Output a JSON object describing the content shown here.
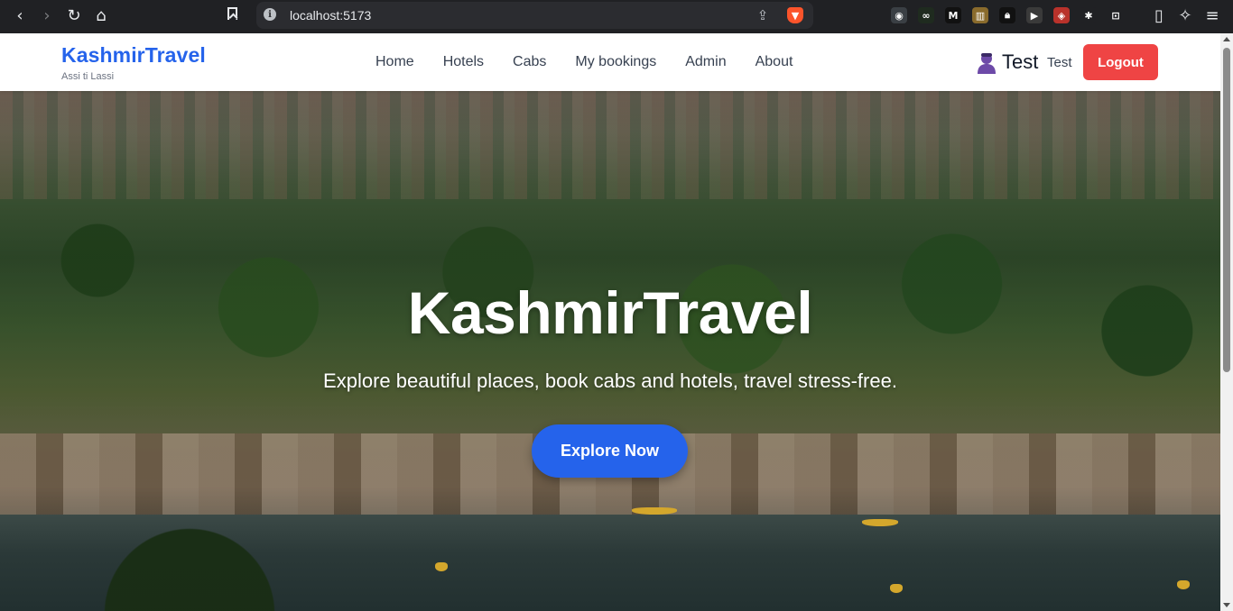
{
  "browser": {
    "url": "localhost:5173",
    "back_icon": "chevron-left-icon",
    "forward_icon": "chevron-right-icon",
    "reload_icon": "reload-icon",
    "home_icon": "home-icon",
    "bookmark_icon": "bookmark-icon",
    "site_info_icon": "info-icon",
    "share_icon": "share-icon",
    "brave_icon": "brave-shield-icon",
    "extensions": [
      {
        "name": "glasses-extension-icon",
        "glyph": "◉",
        "color": "#3a3f44"
      },
      {
        "name": "infinity-extension-icon",
        "glyph": "∞",
        "color": "#1f2b1f"
      },
      {
        "name": "medium-extension-icon",
        "glyph": "M",
        "color": "#111111"
      },
      {
        "name": "colors-extension-icon",
        "glyph": "▥",
        "color": "#8a6b2c"
      },
      {
        "name": "lock-extension-icon",
        "glyph": "🔒︎",
        "color": "#111111"
      },
      {
        "name": "media-extension-icon",
        "glyph": "▶",
        "color": "#3a3a3a"
      },
      {
        "name": "shield-extension-icon",
        "glyph": "◈",
        "color": "#b9322b"
      },
      {
        "name": "puzzle-extension-icon",
        "glyph": "✱",
        "color": "#202124"
      },
      {
        "name": "screenshot-extension-icon",
        "glyph": "⊡",
        "color": "#202124"
      }
    ],
    "sidebar_icon": "sidebar-icon",
    "leo_icon": "sparkle-icon",
    "menu_icon": "menu-icon"
  },
  "navbar": {
    "brand": "KashmirTravel",
    "tagline": "Assi ti Lassi",
    "links": [
      {
        "label": "Home"
      },
      {
        "label": "Hotels"
      },
      {
        "label": "Cabs"
      },
      {
        "label": "My bookings"
      },
      {
        "label": "Admin"
      },
      {
        "label": "About"
      }
    ],
    "user_icon": "user-icon",
    "user_name_large": "Test",
    "user_name_small": "Test",
    "logout_label": "Logout"
  },
  "hero": {
    "title": "KashmirTravel",
    "subtitle": "Explore beautiful places, book cabs and hotels, travel stress-free.",
    "cta_label": "Explore Now"
  },
  "colors": {
    "brand": "#2563eb",
    "logout": "#ef4444",
    "cta": "#2563eb"
  }
}
